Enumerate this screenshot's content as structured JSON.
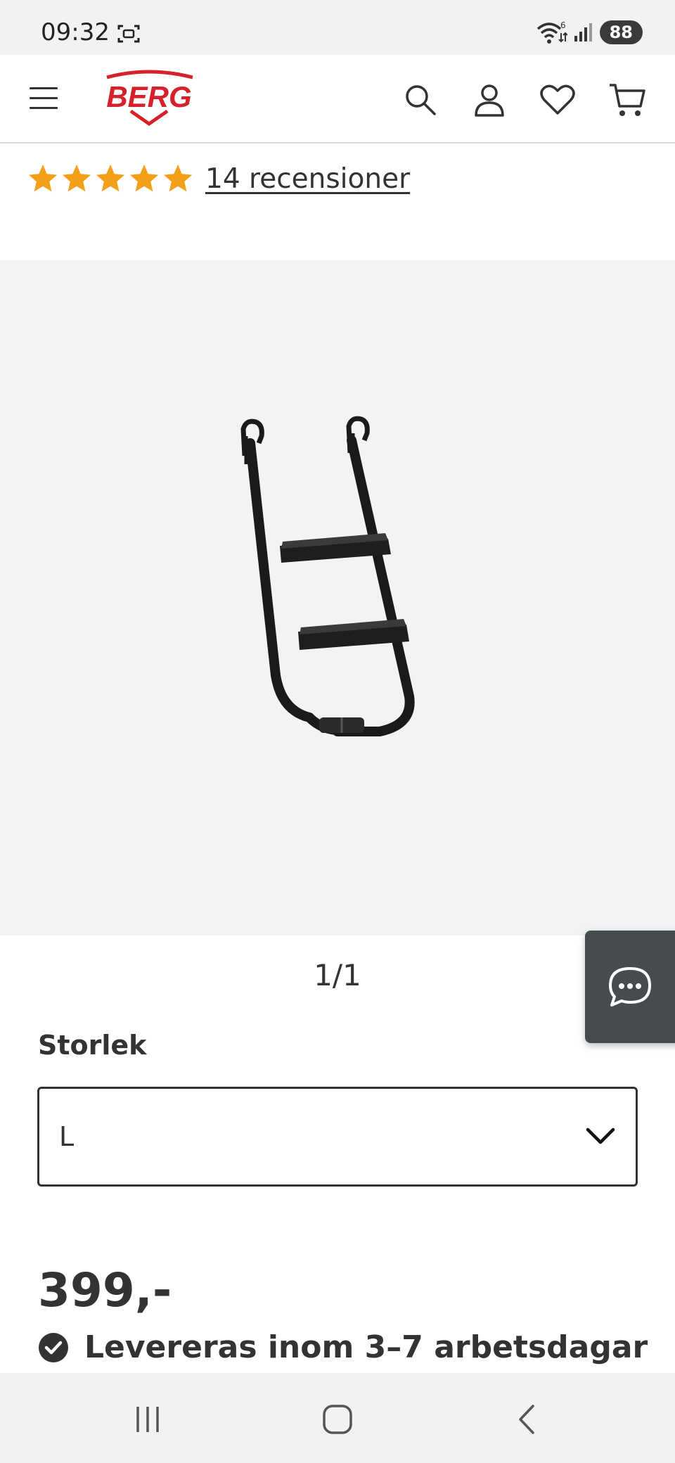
{
  "status_bar": {
    "time": "09:32",
    "battery": "88",
    "wifi_badge": "6"
  },
  "header": {
    "logo_text": "BERG",
    "brand_color": "#d6202a"
  },
  "rating": {
    "stars": 5,
    "star_color": "#f5a01a",
    "reviews_label": "14 recensioner"
  },
  "gallery": {
    "pager": "1/1",
    "background": "#f3f3f3"
  },
  "product": {
    "size_label": "Storlek",
    "size_value": "L",
    "price": "399,-",
    "delivery": "Levereras inom 3–7 arbetsdagar"
  },
  "icons": {
    "menu": "hamburger-icon",
    "search": "search-icon",
    "account": "user-icon",
    "wishlist": "heart-icon",
    "cart": "cart-icon",
    "chat": "chat-icon",
    "chevron": "chevron-down-icon",
    "check": "check-circle-icon"
  }
}
